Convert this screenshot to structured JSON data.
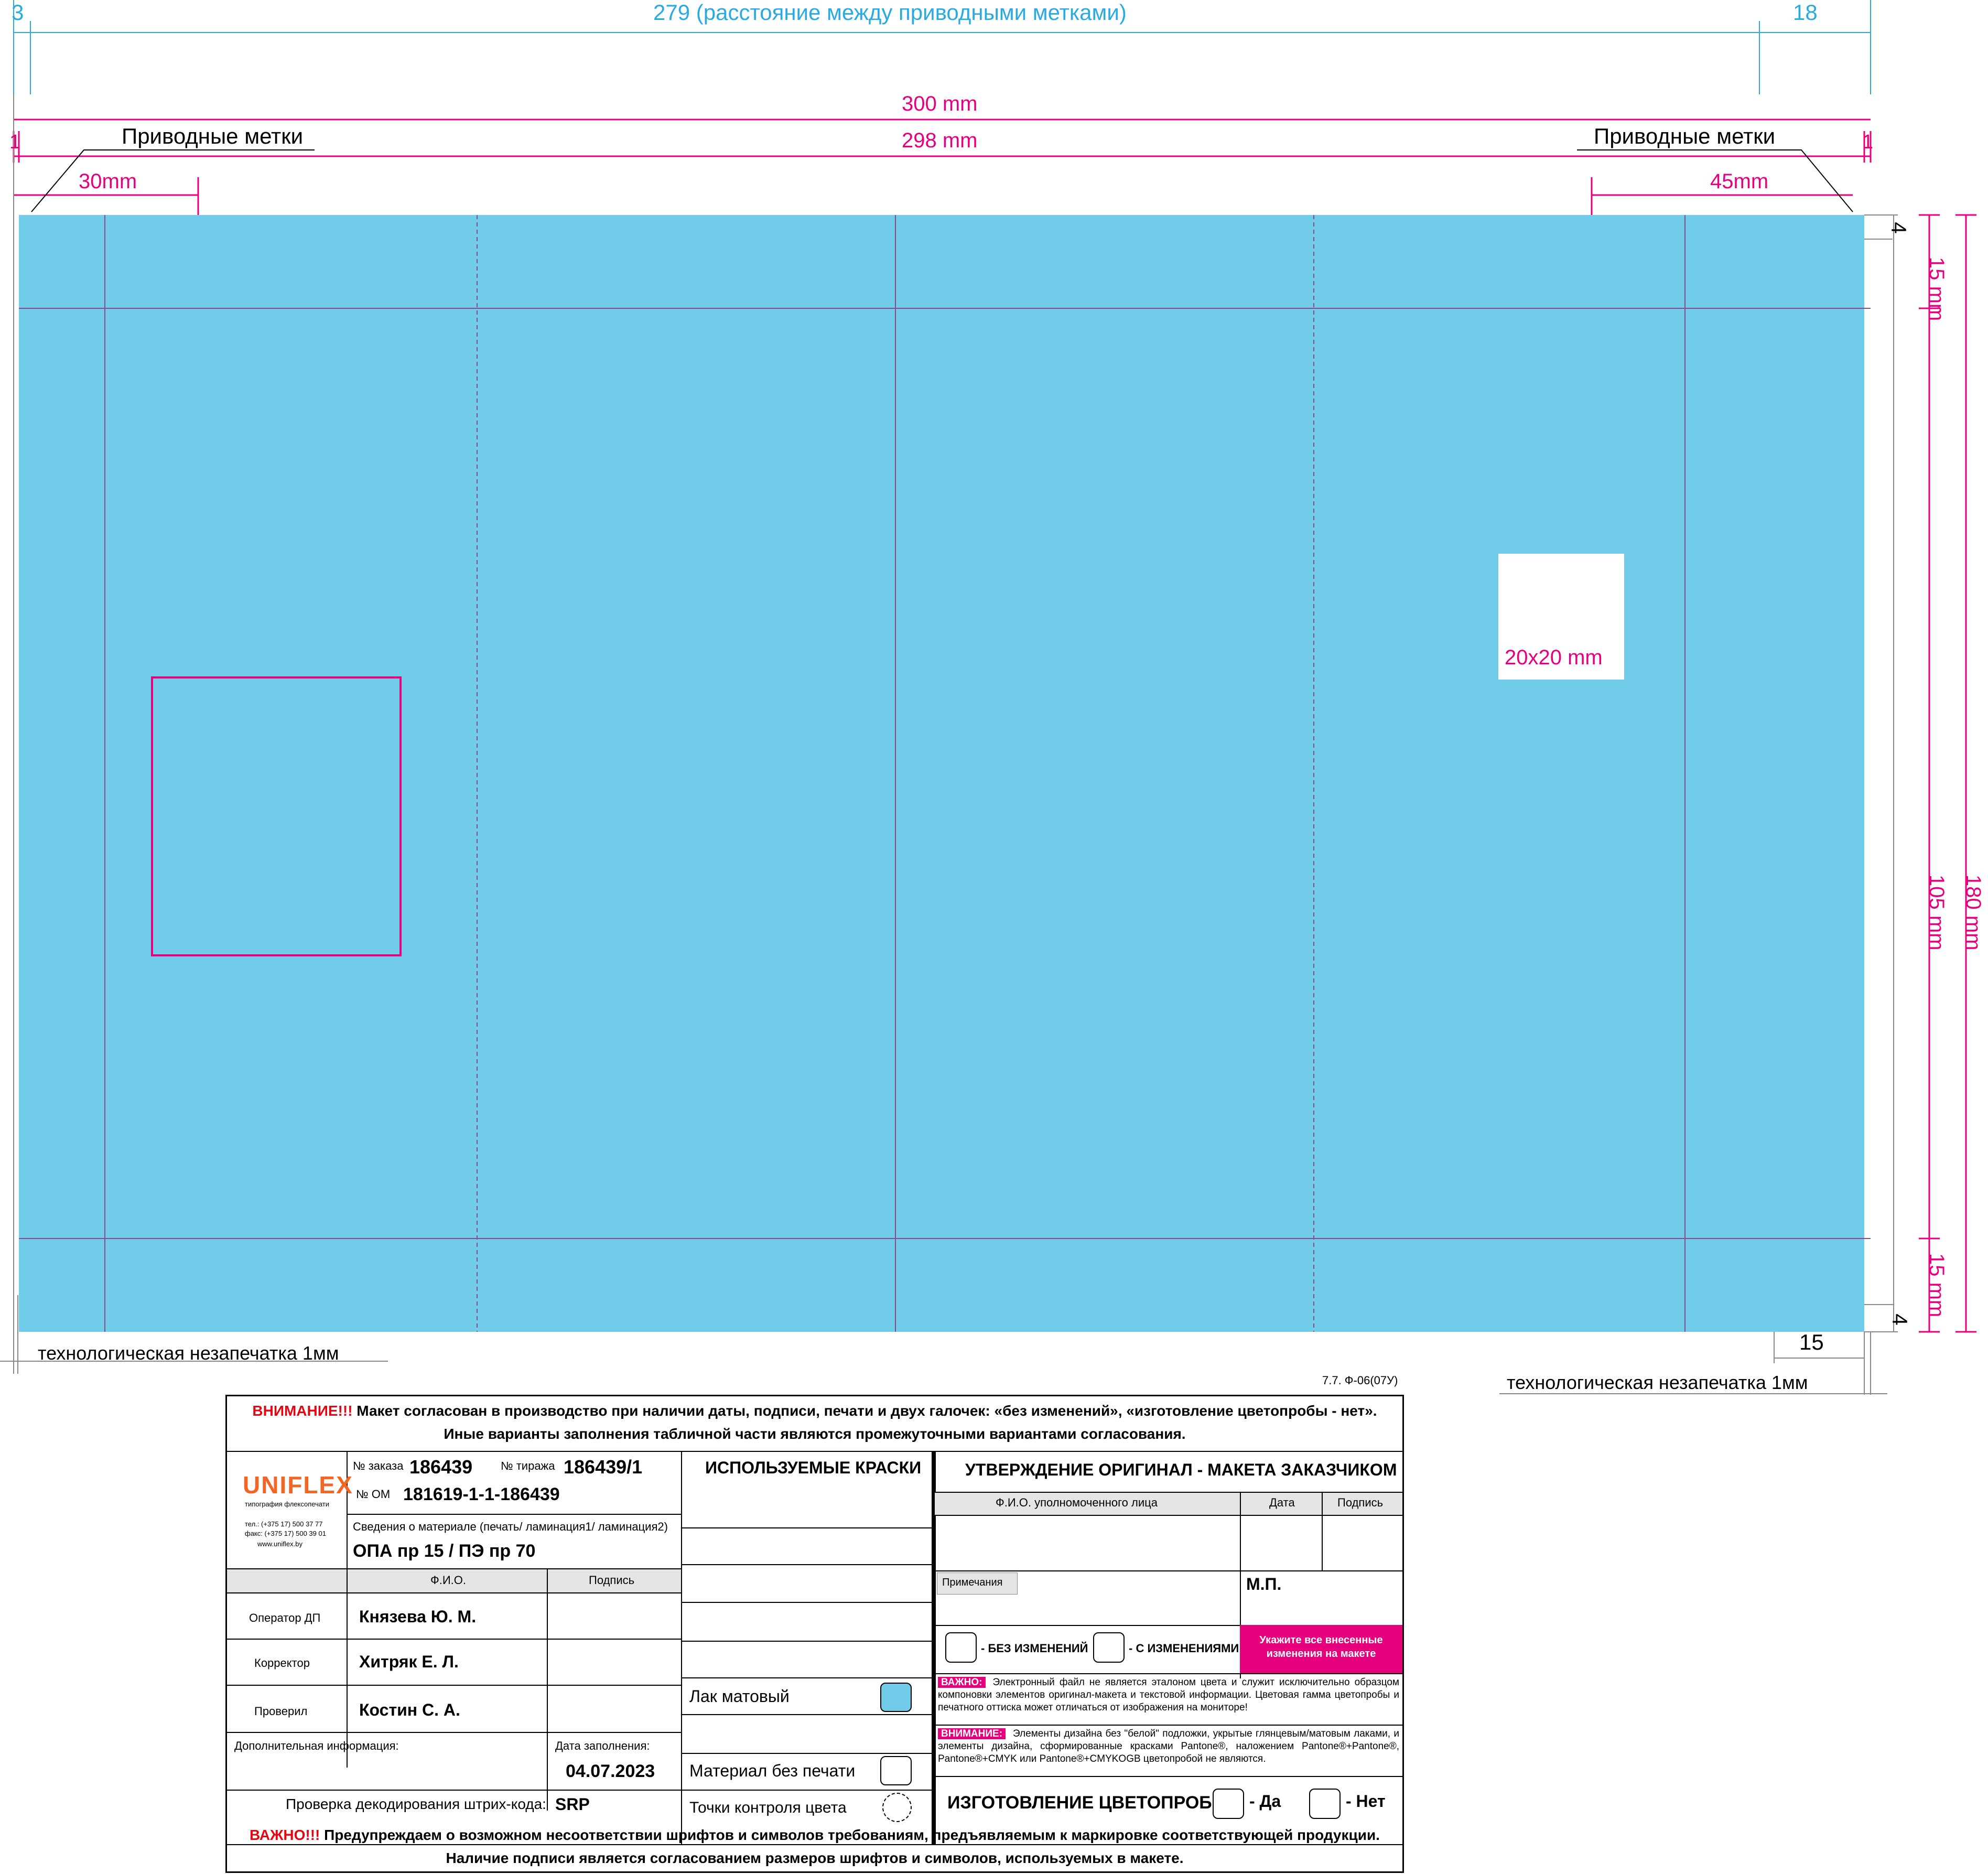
{
  "dims": {
    "distance_label": "279 (расстояние между приводными метками)",
    "left_offset": "3",
    "right_offset": "18",
    "width_300": "300 mm",
    "width_298": "298 mm",
    "marks_left": "Приводные метки",
    "marks_right": "Приводные метки",
    "edge_left": "1",
    "edge_right": "1",
    "left_30": "30mm",
    "right_45": "45mm",
    "top_4": "4",
    "bottom_4": "4",
    "bottom_15": "15",
    "v_top_15": "15 mm",
    "v_middle_105": "105 mm",
    "v_bottom_15": "15 mm",
    "v_total_180": "180 mm",
    "square_label": "20x20 mm",
    "no_print_left": "технологическая незапечатка 1мм",
    "no_print_right": "технологическая незапечатка 1мм",
    "form_code": "7.7. Ф-06(07У)"
  },
  "colors": {
    "fill": "#70cce8",
    "magenta": "#e6007e",
    "cyan": "#29abe2",
    "warn_red": "#e30613",
    "uniflex_orange": "#f26522"
  },
  "form": {
    "attention_word": "ВНИМАНИЕ!!!",
    "attention_text": " Макет согласован в производство при наличии даты, подписи, печати и двух галочек: «без изменений», «изготовление цветопробы - нет».",
    "attention_text2": "Иные варианты заполнения табличной части являются промежуточными вариантами согласования.",
    "logo": "UNIFLEX",
    "logo_sub": "типография флексопечати",
    "phone": "тел.: (+375 17) 500 37 77",
    "fax": "факс: (+375 17) 500 39 01",
    "site": "www.uniflex.by",
    "order_label": "№ заказа",
    "order_value": "186439",
    "run_label": "№ тиража",
    "run_value": "186439/1",
    "om_label": "№ ОМ",
    "om_value": "181619-1-1-186439",
    "material_label": "Сведения о материале (печать/ ламинация1/ ламинация2)",
    "material_value": "ОПА пр 15 / ПЭ пр 70",
    "fio_header": "Ф.И.О.",
    "sign_header": "Подпись",
    "rows": [
      {
        "role": "Оператор ДП",
        "name": "Князева Ю. М."
      },
      {
        "role": "Корректор",
        "name": "Хитряк Е. Л."
      },
      {
        "role": "Проверил",
        "name": "Костин С. А."
      }
    ],
    "extra_info": "Дополнительная информация:",
    "date_label": "Дата заполнения:",
    "date_value": "04.07.2023",
    "barcode_label": "Проверка декодирования штрих-кода:",
    "barcode_value": "SRP",
    "inks_header": "ИСПОЛЬЗУЕМЫЕ КРАСКИ",
    "lak": "Лак матовый",
    "no_print_material": "Материал без печати",
    "color_points": "Точки контроля цвета",
    "approval_title": "УТВЕРЖДЕНИЕ  ОРИГИНАЛ - МАКЕТА ЗАКАЗЧИКОМ",
    "auth_fio": "Ф.И.О. уполномоченного лица",
    "date": "Дата",
    "sign": "Подпись",
    "notes": "Примечания",
    "mp": "М.П.",
    "no_changes": "- БЕЗ ИЗМЕНЕНИЙ",
    "with_changes": "- С ИЗМЕНЕНИЯМИ",
    "indicate_changes": "Укажите все внесенные изменения на макете",
    "important_tag": "ВАЖНО:",
    "important_text": "Электронный файл не является эталоном цвета и служит исключительно образцом компоновки элементов оригинал-макета и текстовой информации. Цветовая гамма цветопробы и печатного оттиска может отличаться от изображения на мониторе!",
    "attention_tag": "ВНИМАНИЕ:",
    "attention_small": "Элементы дизайна без \"белой\" подложки, укрытые глянцевым/матовым лаками, и элементы дизайна, сформированные красками Pantone®, наложением Pantone®+Pantone®, Pantone®+CMYK или Pantone®+CMYKOGB цветопробой не являются.",
    "proof_label": "ИЗГОТОВЛЕНИЕ ЦВЕТОПРОБЫ:",
    "yes": "- Да",
    "no": "- Нет",
    "bottom_word": "ВАЖНО!!!",
    "bottom_text": " Предупреждаем о возможном несоответствии шрифтов и символов требованиям, предъявляемым к маркировке соответствующей продукции.",
    "bottom_text2": "Наличие подписи является согласованием размеров шрифтов и символов, используемых в макете."
  }
}
